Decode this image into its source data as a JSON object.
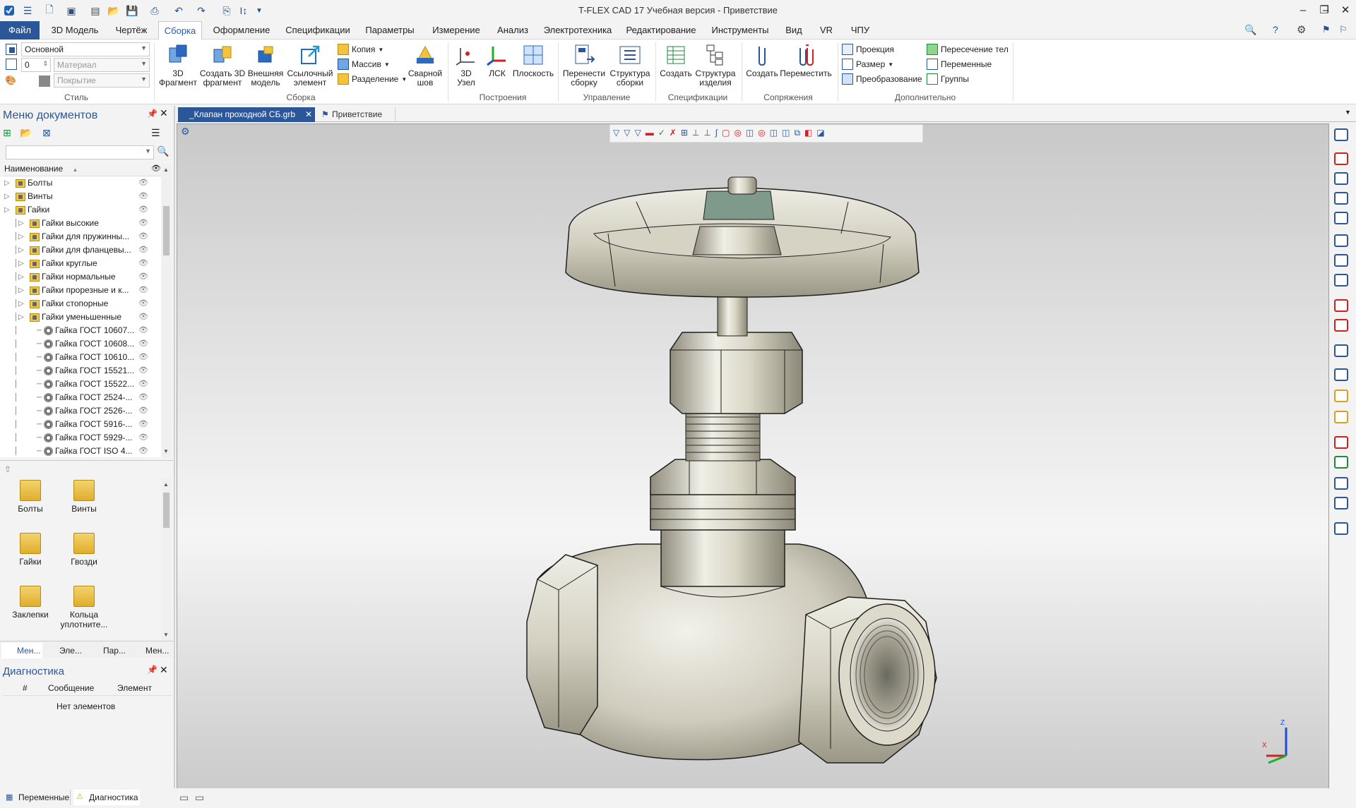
{
  "app": {
    "title": "T-FLEX CAD 17 Учебная версия - Приветствие"
  },
  "menu": {
    "tabs": [
      "Файл",
      "3D Модель",
      "Чертёж",
      "Сборка",
      "Оформление",
      "Спецификации",
      "Параметры",
      "Измерение",
      "Анализ",
      "Электротехника",
      "Редактирование",
      "Инструменты",
      "Вид",
      "VR",
      "ЧПУ"
    ],
    "active": "Сборка"
  },
  "ribbon": {
    "style_group": {
      "label": "Стиль",
      "layer": "Основной",
      "level": "0",
      "material": "Материал",
      "coating": "Покрытие"
    },
    "assembly_group": {
      "label": "Сборка",
      "buttons": [
        {
          "l1": "3D",
          "l2": "Фрагмент"
        },
        {
          "l1": "Создать 3D",
          "l2": "фрагмент"
        },
        {
          "l1": "Внешняя",
          "l2": "модель"
        },
        {
          "l1": "Ссылочный",
          "l2": "элемент"
        }
      ],
      "small": [
        "Копия",
        "Массив",
        "Разделение"
      ],
      "weld": {
        "l1": "Сварной",
        "l2": "шов"
      }
    },
    "build_group": {
      "label": "Построения",
      "buttons": [
        {
          "l1": "3D",
          "l2": "Узел"
        },
        {
          "l1": "ЛСК",
          "l2": ""
        },
        {
          "l1": "Плоскость",
          "l2": ""
        }
      ]
    },
    "manage_group": {
      "label": "Управление",
      "buttons": [
        {
          "l1": "Перенести",
          "l2": "сборку"
        },
        {
          "l1": "Структура",
          "l2": "сборки"
        }
      ]
    },
    "spec_group": {
      "label": "Спецификации",
      "buttons": [
        {
          "l1": "Создать",
          "l2": ""
        },
        {
          "l1": "Структура",
          "l2": "изделия"
        }
      ]
    },
    "mate_group": {
      "label": "Сопряжения",
      "buttons": [
        {
          "l1": "Создать",
          "l2": ""
        },
        {
          "l1": "Переместить",
          "l2": ""
        }
      ]
    },
    "extra_group": {
      "label": "Дополнительно",
      "col1": [
        "Проекция",
        "Размер",
        "Преобразование"
      ],
      "col2": [
        "Пересечение тел",
        "Переменные",
        "Группы"
      ]
    }
  },
  "doc_menu": {
    "title": "Меню документов",
    "column": "Наименование",
    "tree": [
      {
        "label": "Болты",
        "level": 1,
        "type": "folder"
      },
      {
        "label": "Винты",
        "level": 1,
        "type": "folder"
      },
      {
        "label": "Гайки",
        "level": 1,
        "type": "folder"
      },
      {
        "label": "Гайки высокие",
        "level": 2,
        "type": "folder"
      },
      {
        "label": "Гайки для пружинны...",
        "level": 2,
        "type": "folder"
      },
      {
        "label": "Гайки для фланцевы...",
        "level": 2,
        "type": "folder"
      },
      {
        "label": "Гайки круглые",
        "level": 2,
        "type": "folder"
      },
      {
        "label": "Гайки нормальные",
        "level": 2,
        "type": "folder"
      },
      {
        "label": "Гайки прорезные и к...",
        "level": 2,
        "type": "folder"
      },
      {
        "label": "Гайки стопорные",
        "level": 2,
        "type": "folder"
      },
      {
        "label": "Гайки уменьшенные",
        "level": 2,
        "type": "folder"
      },
      {
        "label": "Гайка ГОСТ 10607...",
        "level": 3,
        "type": "nut"
      },
      {
        "label": "Гайка ГОСТ 10608...",
        "level": 3,
        "type": "nut"
      },
      {
        "label": "Гайка ГОСТ 10610...",
        "level": 3,
        "type": "nut"
      },
      {
        "label": "Гайка ГОСТ 15521...",
        "level": 3,
        "type": "nut"
      },
      {
        "label": "Гайка ГОСТ 15522...",
        "level": 3,
        "type": "nut"
      },
      {
        "label": "Гайка ГОСТ 2524-...",
        "level": 3,
        "type": "nut"
      },
      {
        "label": "Гайка ГОСТ 2526-...",
        "level": 3,
        "type": "nut"
      },
      {
        "label": "Гайка ГОСТ 5916-...",
        "level": 3,
        "type": "nut"
      },
      {
        "label": "Гайка ГОСТ 5929-...",
        "level": 3,
        "type": "nut"
      },
      {
        "label": "Гайка ГОСТ ISO 4...",
        "level": 3,
        "type": "nut"
      }
    ],
    "icons": [
      {
        "l1": "Болты",
        "l2": ""
      },
      {
        "l1": "Винты",
        "l2": ""
      },
      {
        "l1": "Гайки",
        "l2": ""
      },
      {
        "l1": "Гвозди",
        "l2": ""
      },
      {
        "l1": "Заклепки",
        "l2": ""
      },
      {
        "l1": "Кольца",
        "l2": "уплотните..."
      }
    ],
    "bottom_tabs": [
      "Мен...",
      "Эле...",
      "Пар...",
      "Мен..."
    ]
  },
  "diagnostics": {
    "title": "Диагностика",
    "columns": [
      "#",
      "Сообщение",
      "Элемент"
    ],
    "empty": "Нет элементов"
  },
  "docs": {
    "tab1": "_Клапан проходной СБ.grb",
    "tab2": "Приветствие"
  },
  "bottom_tabs": [
    "Переменные",
    "Диагностика"
  ],
  "axes": {
    "z": "Z",
    "x": "X"
  },
  "colors": {
    "accent": "#2b579a",
    "part": "#d8d5c6",
    "edge": "#1e1e1e"
  }
}
